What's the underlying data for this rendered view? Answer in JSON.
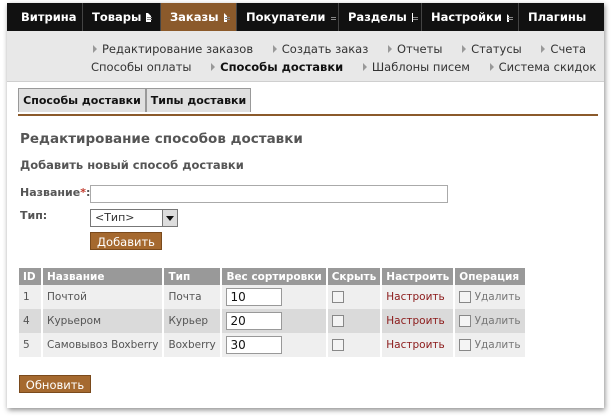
{
  "topnav": {
    "items": [
      {
        "label": "Витрина",
        "active": false
      },
      {
        "label": "Товары",
        "active": false
      },
      {
        "label": "Заказы",
        "active": true
      },
      {
        "label": "Покупатели",
        "active": false
      },
      {
        "label": "Разделы",
        "active": false
      },
      {
        "label": "Настройки",
        "active": false
      },
      {
        "label": "Плагины",
        "active": false
      }
    ]
  },
  "subnav": {
    "row1": [
      "Редактирование заказов",
      "Создать заказ",
      "Отчеты",
      "Статусы",
      "Счета"
    ],
    "row2": [
      {
        "label": "Способы оплаты",
        "bold": false
      },
      {
        "label": "Способы доставки",
        "bold": true
      },
      {
        "label": "Шаблоны писем",
        "bold": false
      },
      {
        "label": "Система скидок",
        "bold": false
      }
    ]
  },
  "tabs": [
    "Способы доставки",
    "Типы доставки"
  ],
  "page": {
    "title": "Редактирование способов доставки",
    "add_section_title": "Добавить новый способ доставки",
    "name_label": "Название",
    "required_mark": "*",
    "name_value": "",
    "type_label": "Тип:",
    "type_selected": "<Тип>",
    "add_button": "Добавить",
    "update_button": "Обновить"
  },
  "table": {
    "columns": [
      "ID",
      "Название",
      "Тип",
      "Вес сортировки",
      "Скрыть",
      "Настроить",
      "Операция"
    ],
    "rows": [
      {
        "id": "1",
        "name": "Почтой",
        "type": "Почта",
        "sort": "10",
        "hidden": false,
        "configure": "Настроить",
        "delete": "Удалить"
      },
      {
        "id": "4",
        "name": "Курьером",
        "type": "Курьер",
        "sort": "20",
        "hidden": false,
        "configure": "Настроить",
        "delete": "Удалить"
      },
      {
        "id": "5",
        "name": "Самовывоз Boxberry",
        "type": "Boxberry",
        "sort": "30",
        "hidden": false,
        "configure": "Настроить",
        "delete": "Удалить"
      }
    ]
  },
  "colors": {
    "accent": "#8b5a2b",
    "button": "#a5692f",
    "link": "#8b1a1a",
    "topbar": "#111111"
  }
}
